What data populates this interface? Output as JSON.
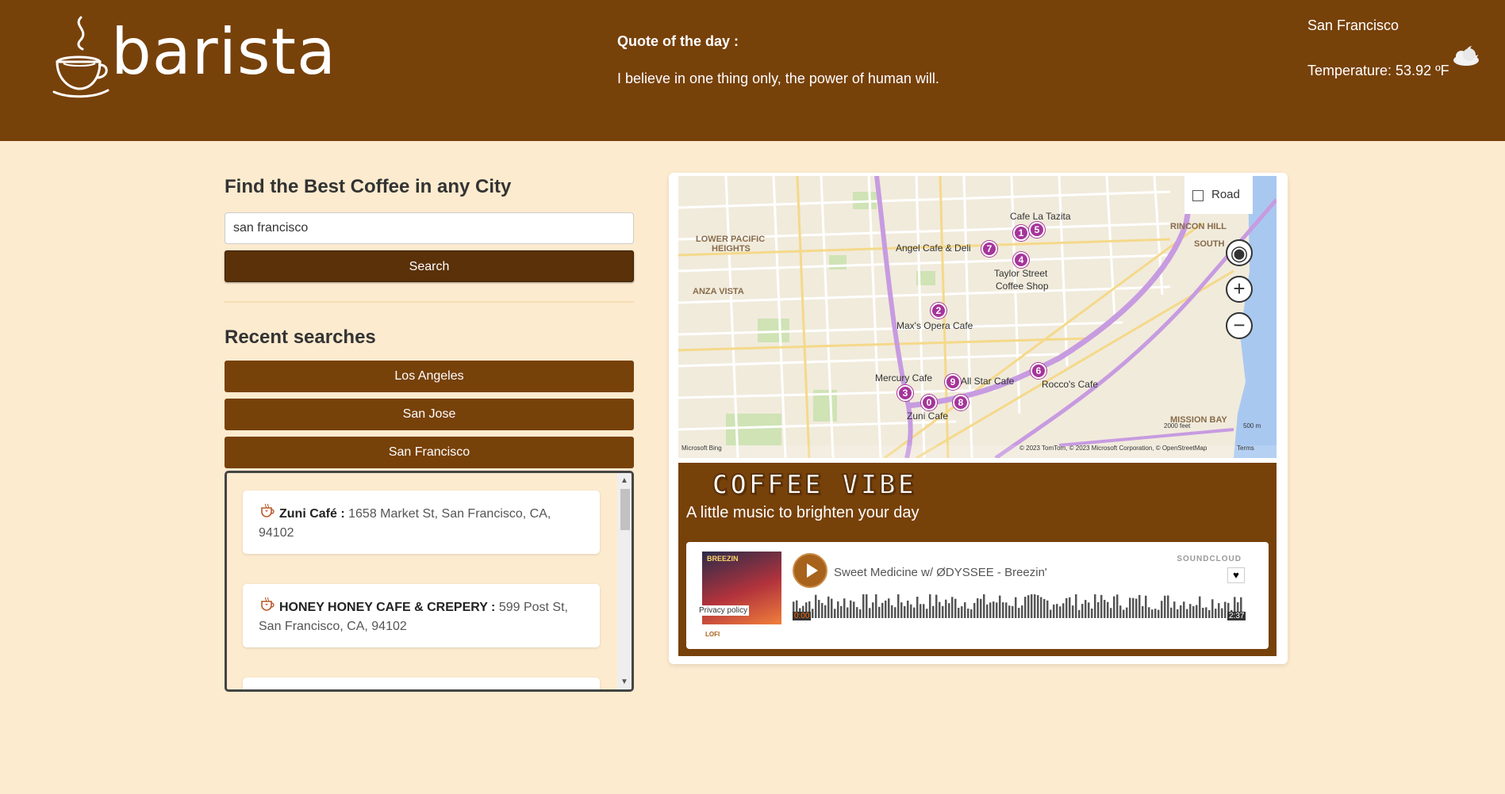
{
  "header": {
    "logo_text": "barista",
    "quote_title": "Quote of the day :",
    "quote_text": "I believe in one thing only, the power of human will.",
    "weather_city": "San Francisco",
    "weather_temp": "Temperature: 53.92 ºF",
    "weather_icon": "cloud-moon-icon"
  },
  "search": {
    "heading": "Find the Best Coffee in any City",
    "value": "san francisco",
    "button_label": "Search"
  },
  "recent": {
    "heading": "Recent searches",
    "items": [
      "Los Angeles",
      "San Jose",
      "San Francisco"
    ]
  },
  "results": [
    {
      "name": "Zuni Café :",
      "address": "1658 Market St, San Francisco, CA, 94102"
    },
    {
      "name": "HONEY HONEY CAFE & CREPERY :",
      "address": "599 Post St, San Francisco, CA, 94102"
    }
  ],
  "map": {
    "style_label": "Road",
    "pins": [
      "1",
      "5",
      "7",
      "4",
      "2",
      "6",
      "9",
      "3",
      "0",
      "8"
    ],
    "place_labels": [
      "Cafe La Tazita",
      "Angel Cafe & Deli",
      "Taylor Street",
      "Coffee Shop",
      "Max's Opera Cafe",
      "Mercury Cafe",
      "All Star Cafe",
      "Rocco's Cafe",
      "Zuni Cafe"
    ],
    "area_labels": [
      "LOWER PACIFIC",
      "HEIGHTS",
      "ANZA VISTA",
      "RINCON HILL",
      "SOUTH",
      "MISSION BAY"
    ],
    "attribution": "© 2023 TomTom, © 2023 Microsoft Corporation, © OpenStreetMap",
    "terms": "Terms",
    "provider": "Microsoft Bing",
    "scale_feet": "2000 feet",
    "scale_m": "500 m"
  },
  "music": {
    "title": "COFFEE VIBE",
    "subtitle": "A little music to brighten your day",
    "track": "Sweet Medicine w/ ØDYSSEE - Breezin'",
    "provider": "SOUNDCLOUD",
    "time_start": "0:00",
    "time_end": "2:37",
    "privacy": "Privacy policy",
    "tag": "LOFI",
    "artwork_text": "BREEZIN"
  },
  "colors": {
    "brand_brown": "#77410a",
    "button_dark": "#5a3108",
    "background": "#fdebcf",
    "pin": "#a5349a"
  }
}
